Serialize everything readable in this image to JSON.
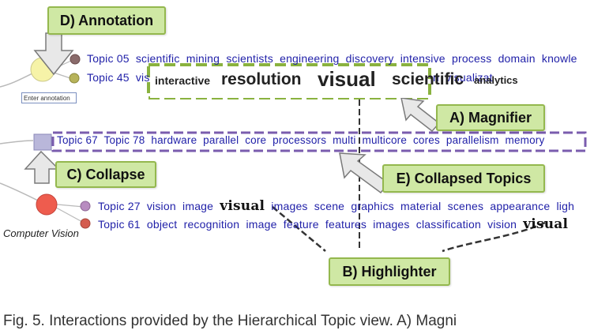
{
  "labels": {
    "annotation": "D) Annotation",
    "magnifier": "A) Magnifier",
    "collapse": "C) Collapse",
    "collapsed_topics": "E) Collapsed Topics",
    "highlighter": "B) Highlighter"
  },
  "annotation_input": {
    "value": "Enter annotation"
  },
  "node_label": "Computer Vision",
  "topics": {
    "t05": {
      "id": "Topic 05",
      "words": "scientific  mining  scientists  engineering  discovery  intensive  process  domain  knowle"
    },
    "t45": {
      "id": "Topic 45",
      "prefix": "vis",
      "suffix": "n  visualizat"
    },
    "collapsed": {
      "ids": "Topic 67  Topic 78",
      "words": "hardware  parallel  core  processors  multi  multicore  cores  parallelism  memory"
    },
    "t27": {
      "id": "Topic 27",
      "before": "vision  image",
      "highlight": "visual",
      "after": "images  scene  graphics  material  scenes  appearance  ligh"
    },
    "t61": {
      "id": "Topic 61",
      "words": "object  recognition  image  feature  features  images  classification  vision",
      "highlight": "visual"
    }
  },
  "magnifier_words": [
    "interactive",
    "resolution",
    "visual",
    "scientific",
    "analytics"
  ],
  "caption": "Fig. 5. Interactions provided by the Hierarchical Topic view. A) Magni",
  "colors": {
    "topic_text": "#1f1fa8",
    "label_fill": "#cfe8a4",
    "magnifier_dash": "#8ab23f",
    "collapsed_dash": "#7a5cae",
    "collapse_square": "#b9b7da",
    "node_red": "#ee5c4e",
    "node_yellow": "#f6f3a8"
  }
}
